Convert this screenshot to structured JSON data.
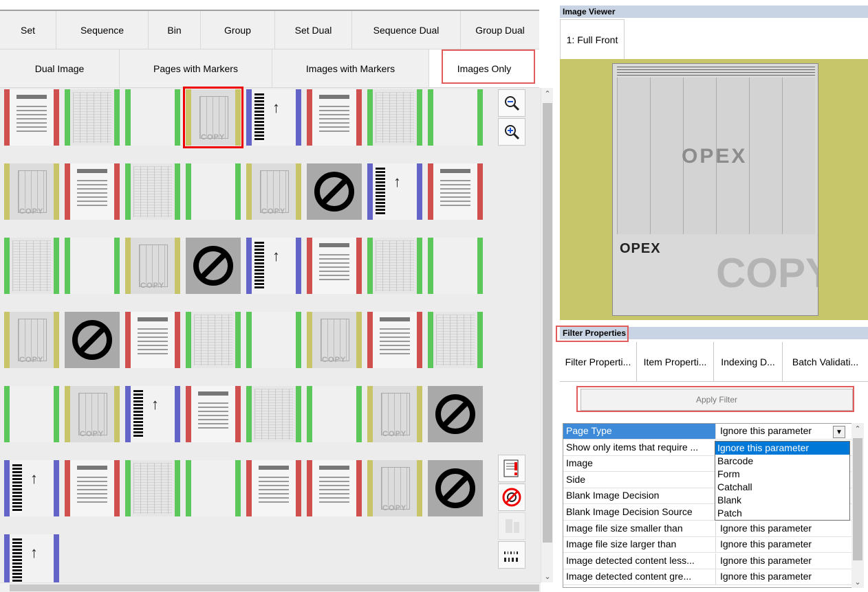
{
  "tabs_row1": [
    "Set",
    "Sequence",
    "Bin",
    "Group",
    "Set Dual",
    "Sequence Dual",
    "Group Dual"
  ],
  "tabs_row2": [
    "Dual Image",
    "Pages with Markers",
    "Images with Markers",
    "Images Only"
  ],
  "active_tab": "Images Only",
  "thumbnail_grid": {
    "rows": [
      [
        "form:red",
        "wide:green",
        "blank:green",
        "check:yellow:selected",
        "patch:blue",
        "form:red",
        "wide:green",
        "blank:green"
      ],
      [
        "check:yellow",
        "form:red",
        "wide:green",
        "blank:green",
        "check:yellow",
        "blocked",
        "patch:blue",
        "form:red"
      ],
      [
        "wide:green",
        "blank:green",
        "check:yellow",
        "blocked",
        "patch:blue",
        "form:red",
        "wide:green",
        "blank:green"
      ],
      [
        "check:yellow",
        "blocked",
        "form:red",
        "wide:green",
        "blank:green",
        "check:yellow",
        "form:red",
        "wide:green"
      ],
      [
        "blank:green",
        "check:yellow",
        "patch:blue",
        "form:red",
        "wide:green",
        "blank:green",
        "check:yellow",
        "blocked"
      ],
      [
        "patch:blue",
        "form:red",
        "wide:green",
        "blank:green",
        "form:red",
        "form:red",
        "check:yellow",
        "blocked"
      ],
      [
        "patch:blue"
      ]
    ],
    "colors": {
      "red": "#d05050",
      "green": "#5cc85c",
      "yellow": "#c8c46a",
      "blue": "#6464c8"
    },
    "thumb_watermark": "COPY"
  },
  "side_buttons": [
    "zoom-out-icon",
    "zoom-in-icon",
    "flag-exception-icon",
    "no-image-icon",
    "dual-page-icon",
    "barcode-icon"
  ],
  "image_viewer": {
    "header": "Image Viewer",
    "tab": "1: Full Front",
    "doc_logo": "OPEX",
    "doc_watermark": "COPY"
  },
  "filter_panel": {
    "header": "Filter Properties",
    "tabs": [
      "Filter Properti...",
      "Item Properti...",
      "Indexing D...",
      "Batch Validati..."
    ],
    "apply_button": "Apply Filter",
    "properties": [
      {
        "name": "Page Type",
        "value": "Ignore this parameter"
      },
      {
        "name": "Show only items that require ...",
        "value": ""
      },
      {
        "name": "Image",
        "value": ""
      },
      {
        "name": "Side",
        "value": ""
      },
      {
        "name": "Blank Image Decision",
        "value": ""
      },
      {
        "name": "Blank Image Decision Source",
        "value": ""
      },
      {
        "name": "Image file size smaller than",
        "value": "Ignore this parameter"
      },
      {
        "name": "Image file size larger than",
        "value": "Ignore this parameter"
      },
      {
        "name": "Image detected content less...",
        "value": "Ignore this parameter"
      },
      {
        "name": "Image detected content gre...",
        "value": "Ignore this parameter"
      }
    ],
    "dropdown_options": [
      "Ignore this parameter",
      "Barcode",
      "Form",
      "Catchall",
      "Blank",
      "Patch"
    ],
    "dropdown_selected": "Ignore this parameter"
  }
}
